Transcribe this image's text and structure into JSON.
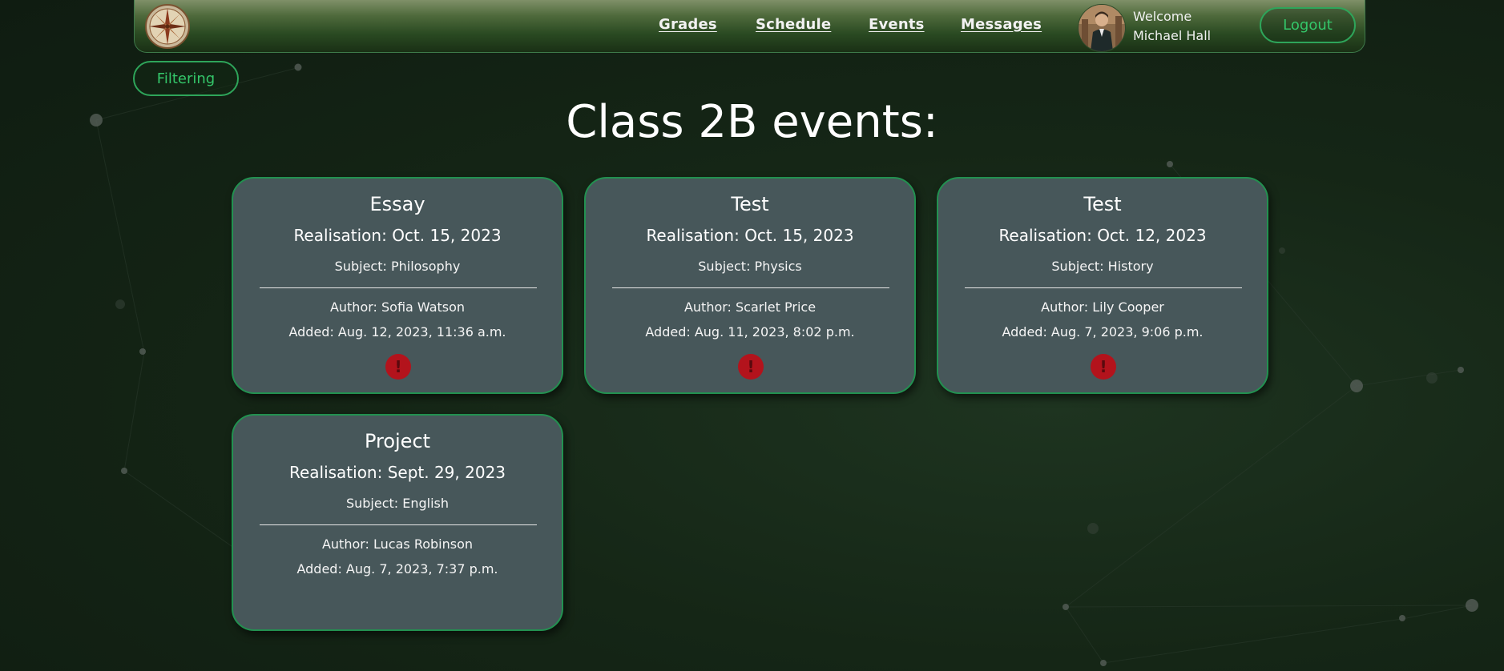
{
  "nav": {
    "links": [
      "Grades",
      "Schedule",
      "Events",
      "Messages"
    ],
    "welcome_line1": "Welcome",
    "welcome_line2": "Michael Hall",
    "logout_label": "Logout"
  },
  "filter_label": "Filtering",
  "page_title": "Class 2B events:",
  "events": [
    {
      "title": "Essay",
      "realisation": "Realisation: Oct. 15, 2023",
      "subject": "Subject: Philosophy",
      "author": "Author: Sofia Watson",
      "added": "Added: Aug. 12, 2023, 11:36 a.m.",
      "alert_icon": "exclamation-circle-icon",
      "alert_symbol": "!"
    },
    {
      "title": "Test",
      "realisation": "Realisation: Oct. 15, 2023",
      "subject": "Subject: Physics",
      "author": "Author: Scarlet Price",
      "added": "Added: Aug. 11, 2023, 8:02 p.m.",
      "alert_icon": "exclamation-circle-icon",
      "alert_symbol": "!"
    },
    {
      "title": "Test",
      "realisation": "Realisation: Oct. 12, 2023",
      "subject": "Subject: History",
      "author": "Author: Lily Cooper",
      "added": "Added: Aug. 7, 2023, 9:06 p.m.",
      "alert_icon": "exclamation-circle-icon",
      "alert_symbol": "!"
    },
    {
      "title": "Project",
      "realisation": "Realisation: Sept. 29, 2023",
      "subject": "Subject: English",
      "author": "Author: Lucas Robinson",
      "added": "Added: Aug. 7, 2023, 7:37 p.m."
    }
  ],
  "colors": {
    "accent_green": "#2ea55a",
    "card_background": "#47575a",
    "alert_red": "#b3131c",
    "page_background": "#152616"
  }
}
